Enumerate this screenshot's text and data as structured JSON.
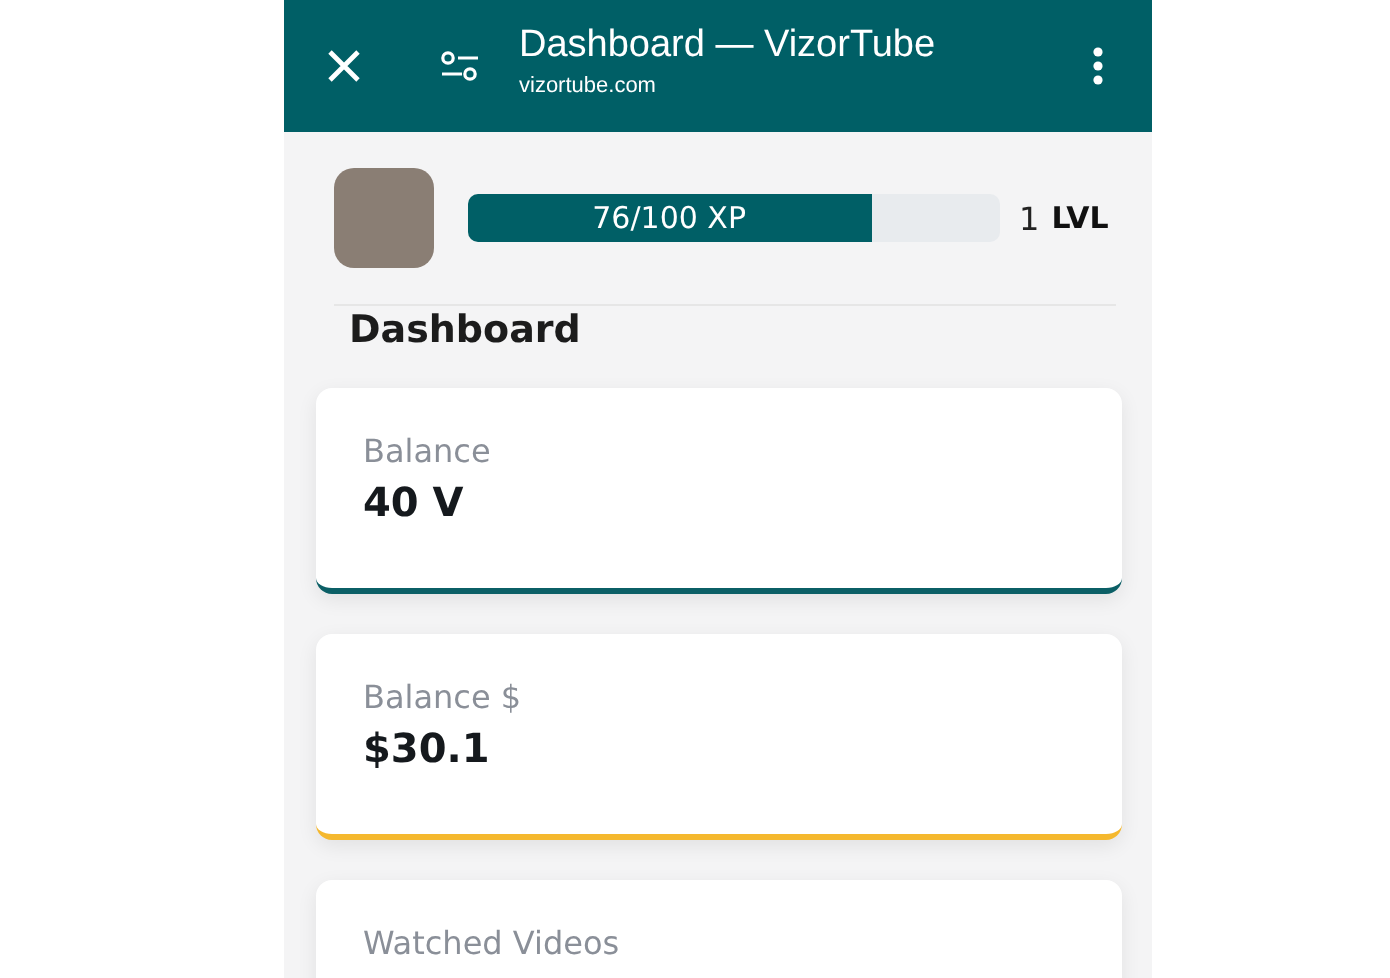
{
  "toolbar": {
    "title": "Dashboard — VizorTube",
    "url": "vizortube.com"
  },
  "profile": {
    "xp": {
      "label": "76/100 XP",
      "level": 0.76
    },
    "lvl_number": "1",
    "lvl_label": "LVL"
  },
  "heading": "Dashboard",
  "cards": [
    {
      "label": "Balance",
      "value": "40 V",
      "color": "#0b5f66"
    },
    {
      "label": "Balance $",
      "value": "$30.1",
      "color": "#f5b82e"
    },
    {
      "label": "Watched Videos"
    }
  ]
}
